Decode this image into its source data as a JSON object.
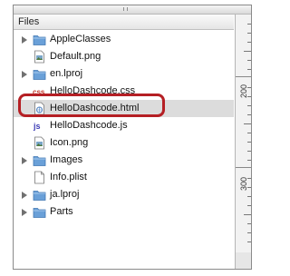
{
  "panel": {
    "header": "Files",
    "items": [
      {
        "label": "AppleClasses",
        "icon": "folder-icon",
        "expandable": true
      },
      {
        "label": "Default.png",
        "icon": "image-file-icon",
        "expandable": false
      },
      {
        "label": "en.lproj",
        "icon": "folder-icon",
        "expandable": true
      },
      {
        "label": "HelloDashcode.css",
        "icon": "css-file-icon",
        "expandable": false
      },
      {
        "label": "HelloDashcode.html",
        "icon": "html-file-icon",
        "expandable": false,
        "selected": true
      },
      {
        "label": "HelloDashcode.js",
        "icon": "js-file-icon",
        "expandable": false
      },
      {
        "label": "Icon.png",
        "icon": "image-file-icon",
        "expandable": false
      },
      {
        "label": "Images",
        "icon": "folder-icon",
        "expandable": true
      },
      {
        "label": "Info.plist",
        "icon": "document-icon",
        "expandable": false
      },
      {
        "label": "ja.lproj",
        "icon": "folder-icon",
        "expandable": true
      },
      {
        "label": "Parts",
        "icon": "folder-icon",
        "expandable": true
      }
    ]
  },
  "ruler": {
    "labels": [
      "200",
      "300"
    ]
  },
  "colors": {
    "highlight": "#b51f24",
    "folder": "#6aa0d8"
  }
}
